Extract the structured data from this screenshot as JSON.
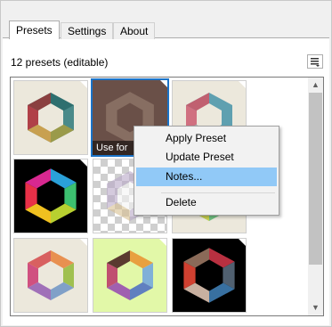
{
  "tabs": [
    {
      "label": "Presets",
      "active": true
    },
    {
      "label": "Settings",
      "active": false
    },
    {
      "label": "About",
      "active": false
    }
  ],
  "status_text": "12 presets (editable)",
  "menu_button_icon": "list-menu-icon",
  "presets": [
    {
      "style": "light",
      "caption": ""
    },
    {
      "style": "selected",
      "caption": "Use for"
    },
    {
      "style": "light",
      "caption": ""
    },
    {
      "style": "dark",
      "caption": ""
    },
    {
      "style": "checker",
      "caption": ""
    },
    {
      "style": "light",
      "caption": ""
    },
    {
      "style": "light",
      "caption": ""
    },
    {
      "style": "lime",
      "caption": ""
    },
    {
      "style": "dark",
      "caption": ""
    }
  ],
  "context_menu": {
    "items": [
      "Apply Preset",
      "Update Preset",
      "Notes...",
      "Delete"
    ],
    "hovered": "Notes..."
  },
  "scrollbar": {
    "up_icon": "up-arrow-icon",
    "down_icon": "down-arrow-icon"
  },
  "colors": {
    "accent": "#1a73c8",
    "hover": "#91c9f7"
  }
}
